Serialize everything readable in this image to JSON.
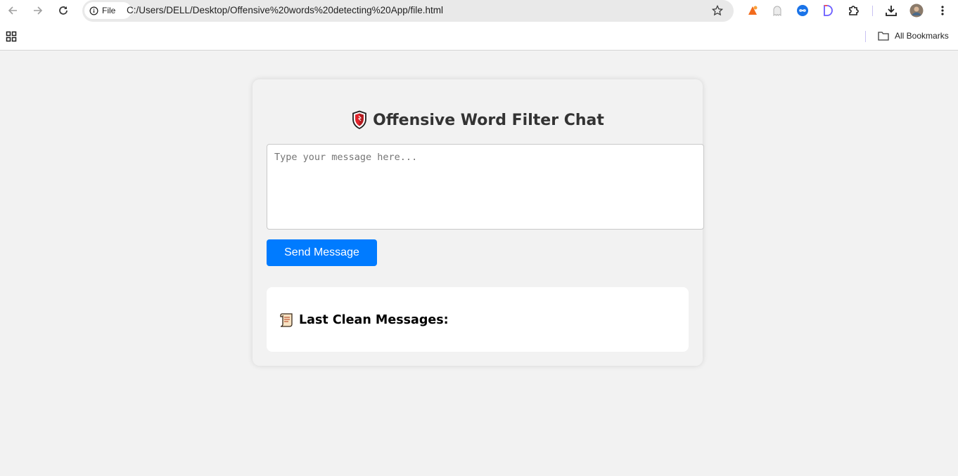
{
  "browser": {
    "url_chip_label": "File",
    "url": "C:/Users/DELL/Desktop/Offensive%20words%20detecting%20App/file.html",
    "bookmarks_label": "All Bookmarks",
    "icons": {
      "back": "back-arrow-icon",
      "forward": "forward-arrow-icon",
      "reload": "reload-icon",
      "info": "info-icon",
      "star": "star-icon",
      "extensions": "puzzle-icon",
      "downloads": "download-icon",
      "menu": "kebab-menu-icon",
      "apps": "apps-grid-icon",
      "folder": "folder-icon"
    }
  },
  "app": {
    "title": "Offensive Word Filter Chat",
    "title_icon": "shield-icon",
    "input_placeholder": "Type your message here...",
    "input_value": "",
    "send_label": "Send Message",
    "history_title": "Last Clean Messages:",
    "history_icon": "scroll-icon",
    "colors": {
      "accent": "#007bff",
      "page_bg": "#f2f2f2",
      "title": "#333333"
    }
  }
}
